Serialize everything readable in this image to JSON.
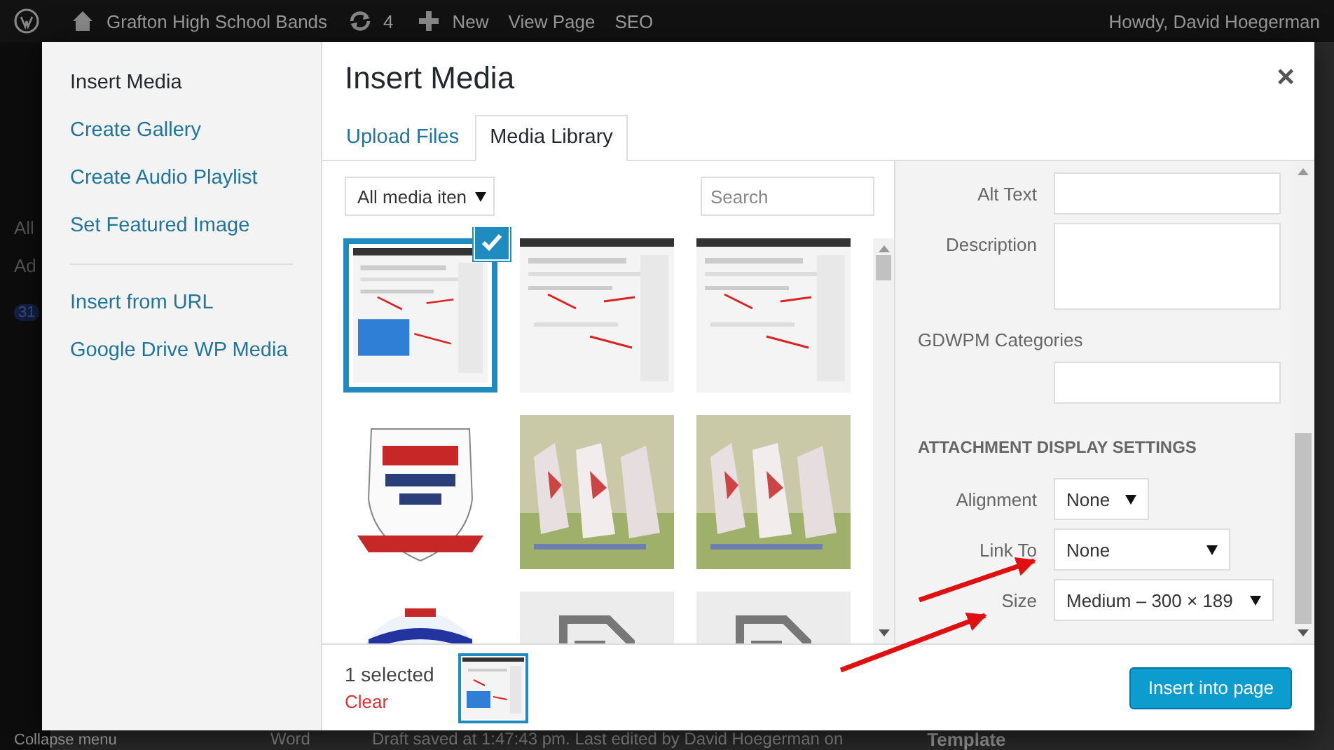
{
  "admin_bar": {
    "site_name": "Grafton High School Bands",
    "updates": "4",
    "new": "New",
    "view_page": "View Page",
    "seo": "SEO",
    "greeting": "Howdy, David Hoegerman"
  },
  "background": {
    "menu_texts": [
      "All",
      "Ad",
      "31"
    ],
    "collapse": "Collapse menu",
    "word_label": "Word",
    "status": "Draft saved at 1:47:43 pm. Last edited by David Hoegerman on",
    "template_heading": "Template"
  },
  "modal": {
    "menu_groups": [
      [
        {
          "label": "Insert Media",
          "selected": true
        },
        {
          "label": "Create Gallery",
          "selected": false
        },
        {
          "label": "Create Audio Playlist",
          "selected": false
        },
        {
          "label": "Set Featured Image",
          "selected": false
        }
      ],
      [
        {
          "label": "Insert from URL",
          "selected": false
        },
        {
          "label": "Google Drive WP Media",
          "selected": false
        }
      ]
    ],
    "title": "Insert Media",
    "close": "×",
    "tabs": [
      {
        "label": "Upload Files",
        "selected": false
      },
      {
        "label": "Media Library",
        "selected": true
      }
    ],
    "filter": {
      "value": "All media iten"
    },
    "search": {
      "placeholder": "Search"
    },
    "items": [
      {
        "kind": "picture",
        "selected": true
      },
      {
        "kind": "picture",
        "selected": false
      },
      {
        "kind": "picture",
        "selected": false
      },
      {
        "kind": "picture",
        "selected": false
      },
      {
        "kind": "picture",
        "selected": false
      },
      {
        "kind": "picture",
        "selected": false
      },
      {
        "kind": "picture",
        "selected": false
      },
      {
        "kind": "document",
        "selected": false
      },
      {
        "kind": "document",
        "selected": false
      }
    ],
    "details": [
      {
        "label": "Alt Text",
        "kind": "input"
      },
      {
        "label": "Description",
        "kind": "textarea"
      },
      {
        "label": "GDWPM Categories",
        "kind": "stacked"
      }
    ],
    "display_settings": {
      "heading": "ATTACHMENT DISPLAY SETTINGS",
      "fields": [
        {
          "label": "Alignment",
          "value": "None"
        },
        {
          "label": "Link To",
          "value": "None"
        },
        {
          "label": "Size",
          "value": "Medium – 300 × 189"
        }
      ]
    },
    "footer": {
      "selected_count": "1 selected",
      "clear": "Clear",
      "button": "Insert into page"
    }
  }
}
